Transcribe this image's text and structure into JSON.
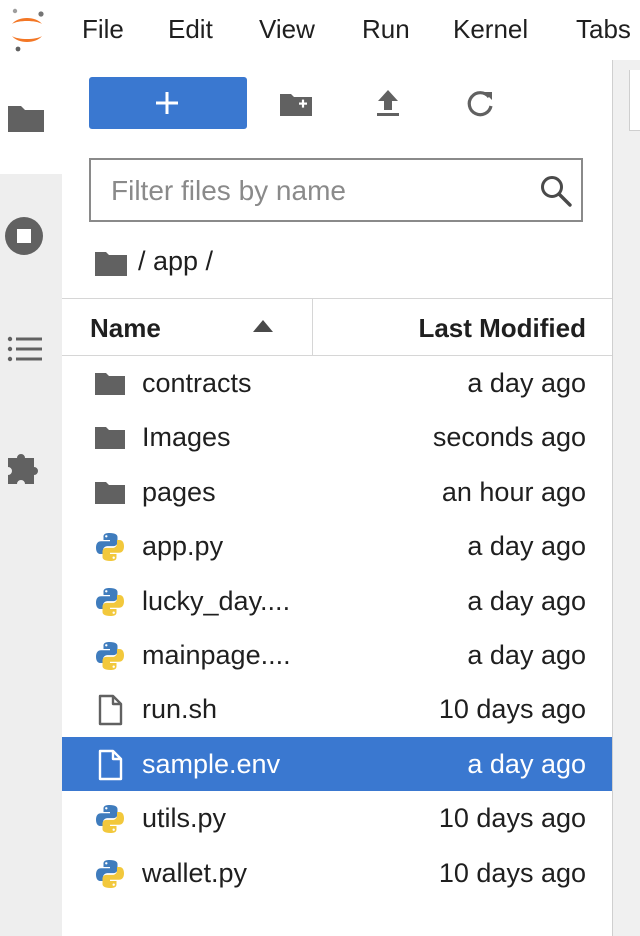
{
  "menubar": {
    "items": [
      "File",
      "Edit",
      "View",
      "Run",
      "Kernel",
      "Tabs"
    ]
  },
  "activitybar": {
    "icons": [
      "folder-icon",
      "running-stop-icon",
      "table-of-contents-icon",
      "extension-puzzle-icon"
    ]
  },
  "toolbar": {
    "new_label": "+"
  },
  "filter": {
    "placeholder": "Filter files by name"
  },
  "breadcrumb": {
    "path": "/ app /"
  },
  "table": {
    "columns": {
      "name": "Name",
      "modified": "Last Modified"
    },
    "rows": [
      {
        "name": "contracts",
        "modified": "a day ago",
        "kind": "folder"
      },
      {
        "name": "Images",
        "modified": "seconds ago",
        "kind": "folder"
      },
      {
        "name": "pages",
        "modified": "an hour ago",
        "kind": "folder"
      },
      {
        "name": "app.py",
        "modified": "a day ago",
        "kind": "python"
      },
      {
        "name": "lucky_day....",
        "modified": "a day ago",
        "kind": "python"
      },
      {
        "name": "mainpage....",
        "modified": "a day ago",
        "kind": "python"
      },
      {
        "name": "run.sh",
        "modified": "10 days ago",
        "kind": "file"
      },
      {
        "name": "sample.env",
        "modified": "a day ago",
        "kind": "file",
        "selected": true
      },
      {
        "name": "utils.py",
        "modified": "10 days ago",
        "kind": "python"
      },
      {
        "name": "wallet.py",
        "modified": "10 days ago",
        "kind": "python"
      }
    ]
  },
  "colors": {
    "accent": "#3a78d0",
    "folder": "#616161",
    "python_blue": "#3f7cbd",
    "python_yellow": "#f2c83c"
  }
}
